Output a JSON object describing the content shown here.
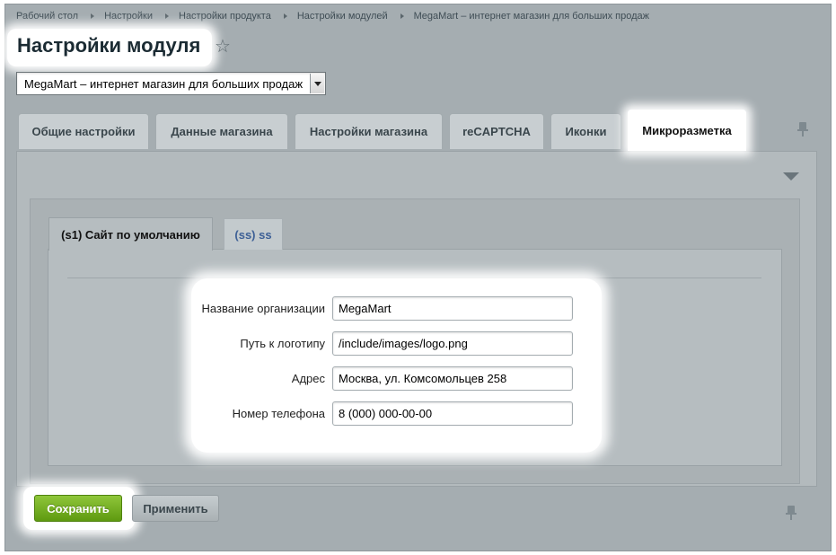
{
  "breadcrumb": [
    "Рабочий стол",
    "Настройки",
    "Настройки продукта",
    "Настройки модулей",
    "MegaMart – интернет магазин для больших продаж"
  ],
  "page": {
    "title": "Настройки модуля",
    "star_icon": "☆"
  },
  "site_select": {
    "value": "MegaMart – интернет магазин для больших продаж"
  },
  "tabs": [
    {
      "label": "Общие настройки"
    },
    {
      "label": "Данные магазина"
    },
    {
      "label": "Настройки магазина"
    },
    {
      "label": "reCAPTCHA"
    },
    {
      "label": "Иконки"
    },
    {
      "label": "Микроразметка",
      "active": true
    }
  ],
  "subtabs": [
    {
      "label": "(s1) Сайт по умолчанию",
      "active": true
    },
    {
      "label": "(ss) ss"
    }
  ],
  "form": {
    "org_name": {
      "label": "Название организации",
      "value": "MegaMart"
    },
    "logo_path": {
      "label": "Путь к логотипу",
      "value": "/include/images/logo.png"
    },
    "address": {
      "label": "Адрес",
      "value": "Москва, ул. Комсомольцев 258"
    },
    "phone": {
      "label": "Номер телефона",
      "value": "8 (000) 000-00-00"
    }
  },
  "buttons": {
    "save": "Сохранить",
    "apply": "Применить"
  },
  "colors": {
    "save_green": "#6aa918",
    "link_blue": "#3d6096",
    "frame_gray": "#a5adb1"
  }
}
